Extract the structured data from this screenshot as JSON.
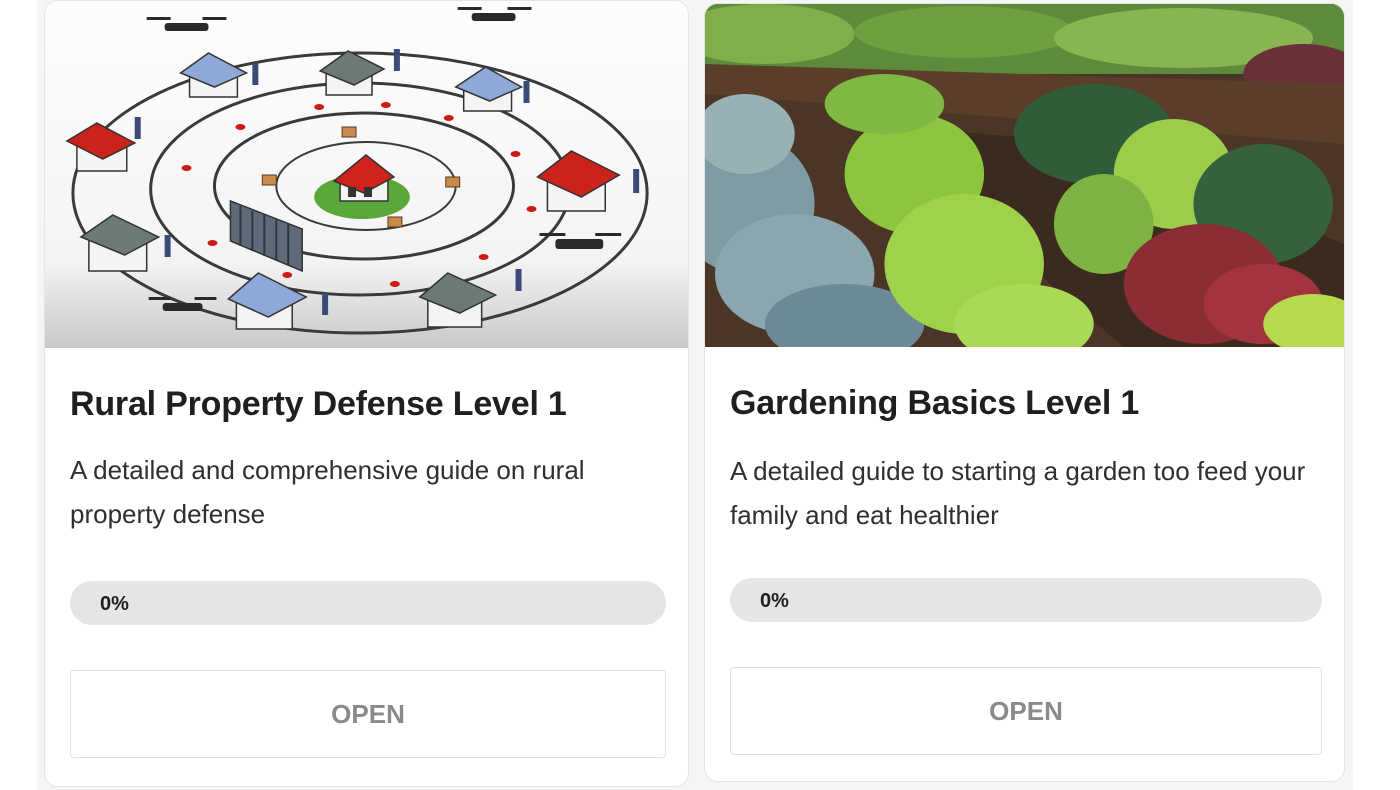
{
  "courses": [
    {
      "title": "Rural Property Defense Level 1",
      "description": "A detailed and comprehensive guide on rural property defense",
      "progress_label": "0%",
      "progress": 0,
      "button_label": "OPEN",
      "image": "rural-property-defense-illustration"
    },
    {
      "title": "Gardening Basics Level 1",
      "description": "A detailed guide to starting a garden too feed your family and eat healthier",
      "progress_label": "0%",
      "progress": 0,
      "button_label": "OPEN",
      "image": "vegetable-garden-photo"
    }
  ],
  "colors": {
    "progress_track": "#e5e5e5",
    "button_text": "#8a8a8a",
    "title_text": "#1f1f1f"
  }
}
